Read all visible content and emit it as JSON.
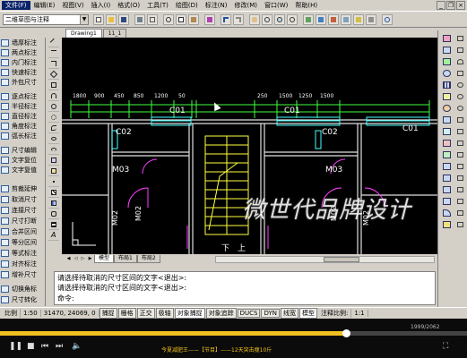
{
  "menubar": {
    "items": [
      "文件(F)",
      "编辑(E)",
      "视图(V)",
      "插入(I)",
      "格式(O)",
      "工具(T)",
      "绘图(D)",
      "标注(N)",
      "修改(M)",
      "窗口(W)",
      "帮助(H)"
    ]
  },
  "toolbar": {
    "workspace_value": "二维草图与注释"
  },
  "drawing_tabs": [
    "Drawing1",
    "11_1"
  ],
  "left_palette": {
    "items": [
      "墙厚标注",
      "两点标注",
      "内门标注",
      "快速标注",
      "外包尺寸",
      "逐点标注",
      "半径标注",
      "直径标注",
      "角度标注",
      "弧长标注",
      "尺寸编辑",
      "文字复位",
      "文字复值",
      "剪裁延伸",
      "取消尺寸",
      "连接尺寸",
      "尺寸打断",
      "合并区间",
      "等分区间",
      "等式标注",
      "对齐标注",
      "增补尺寸",
      "切换角标",
      "尺寸转化"
    ]
  },
  "canvas": {
    "dims_top_left": [
      "1800",
      "900",
      "450",
      "850",
      "1200",
      "50"
    ],
    "dims_top_right": [
      "250",
      "1500",
      "1250",
      "1500"
    ],
    "labels": {
      "c01_a": "C01",
      "c01_b": "C01",
      "c01_c": "C01",
      "c02_a": "C02",
      "c02_b": "C02",
      "m03_a": "M03",
      "m03_b": "M03",
      "m02_a": "M02",
      "m02_b": "M02",
      "m02_c": "M02",
      "m02_d": "M02",
      "up": "上",
      "down": "下"
    },
    "watermark": "微世代品牌设计"
  },
  "layout_tabs": [
    "模型",
    "布局1",
    "布局2"
  ],
  "command": {
    "line1": "请选择待取消的尺寸区间的文字<退出>:",
    "line2": "请选择待取消的尺寸区间的文字<退出>:",
    "prompt": "命令:"
  },
  "statusbar": {
    "scale_label": "比例",
    "scale_value": "1:50",
    "coords": "31470, 24069, 0",
    "toggles": [
      "捕捉",
      "栅格",
      "正交",
      "极轴",
      "对象捕捉",
      "对象追踪",
      "DUCS",
      "DYN",
      "线宽",
      "模型"
    ],
    "anno_label": "注释比例:",
    "anno_value": "1:1"
  },
  "player": {
    "title": "今夏减肥王——【节目】——12天突击瘦10斤",
    "time": "1999/2062",
    "progress": 0.74,
    "colors": {
      "progress": "#f0c020"
    }
  }
}
